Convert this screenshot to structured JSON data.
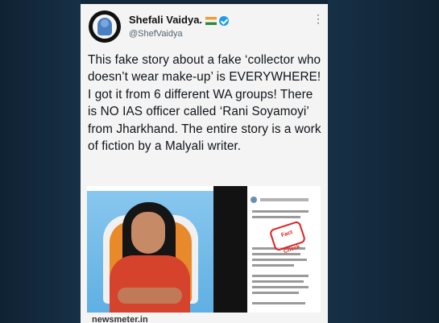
{
  "tweet": {
    "display_name": "Shefali Vaidya.",
    "handle": "@ShefVaidya",
    "text": "This fake story about a fake ‘collector who doesn’t wear make-up’ is EVERYWHERE! I got it from 6 different WA groups! There is NO IAS officer called ‘Rani Soyamoyi’ from Jharkhand. The entire story is a work of fiction by a Malyali writer.",
    "more_menu": "⋮"
  },
  "media": {
    "stamp_text": "Fact Check"
  },
  "footer": {
    "source": "newsmeter.in"
  },
  "colors": {
    "verified": "#1d9bf0",
    "stamp": "#dd2222",
    "background": "#12283a"
  }
}
